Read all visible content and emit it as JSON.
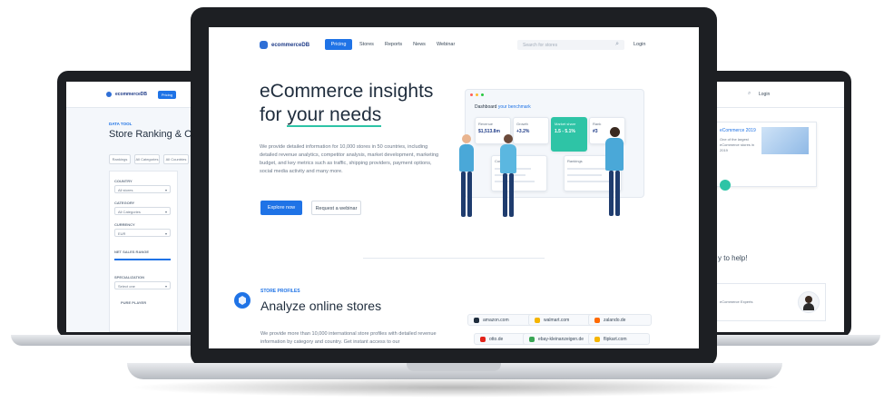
{
  "center": {
    "logo_text": "ecommerceDB",
    "nav": {
      "pricing": "Pricing",
      "stores": "Stores",
      "reports": "Reports",
      "news": "News",
      "webinar": "Webinar",
      "search_placeholder": "Search for stores",
      "login": "Login"
    },
    "hero": {
      "title_line1": "eCommerce insights",
      "title_line2_prefix": "for ",
      "title_line2_highlight": "your needs",
      "paragraph": "We provide detailed information for 10,000 stores in 50 countries, including detailed revenue analytics, competitor analysis, market development, marketing budget, and key metrics such as traffic, shipping providers, payment options, social media activity and many more.",
      "explore_button": "Explore now",
      "webinar_button": "Request a webinar"
    },
    "dashboard": {
      "heading_prefix": "Dashboard",
      "heading_highlight": "your benchmark",
      "metrics": [
        {
          "label": "Revenue",
          "value": "$1,513.8m"
        },
        {
          "label": "Growth",
          "value": "+3.2%"
        },
        {
          "label": "Market share",
          "value": "1.5 - 5.1%"
        },
        {
          "label": "Rank",
          "value": "#3"
        }
      ],
      "panel_left_title": "Competitors",
      "panel_right_title": "Rankings"
    },
    "profiles": {
      "eyebrow": "STORE PROFILES",
      "title": "Analyze online stores",
      "paragraph": "We provide more than 10,000 international store profiles with detailed revenue information by category and country. Get instant access to our",
      "stores": [
        {
          "name": "amazon.com",
          "color": "#1f2d3d"
        },
        {
          "name": "walmart.com",
          "color": "#f5b400"
        },
        {
          "name": "zalando.de",
          "color": "#ff6a00"
        },
        {
          "name": "otto.de",
          "color": "#e2231a"
        },
        {
          "name": "ebay-kleinanzeigen.de",
          "color": "#3aa655"
        },
        {
          "name": "flipkart.com",
          "color": "#f5b400"
        }
      ]
    }
  },
  "left": {
    "logo_text": "ecommerceDB",
    "nav_pricing": "Pricing",
    "eyebrow": "DATA TOOL",
    "title": "Store Ranking & Ove",
    "tabs": [
      "Rankings",
      "All Categories",
      "All Countries"
    ],
    "filters": [
      {
        "label": "COUNTRY",
        "value": "All stores"
      },
      {
        "label": "CATEGORY",
        "value": "All Categories"
      },
      {
        "label": "CURRENCY",
        "value": "EUR"
      },
      {
        "label": "NET SALES RANGE",
        "value": ""
      },
      {
        "label": "SPECIALIZATION",
        "value": "Select one"
      }
    ],
    "footer_label": "PURE PLAYER"
  },
  "right": {
    "search_hint": "Login",
    "news_title": "eCommerce 2019",
    "news_text": "One of the largest eCommerce stores in 2019",
    "help_text": "y to help!",
    "contact_text": "eCommerce Experts"
  }
}
